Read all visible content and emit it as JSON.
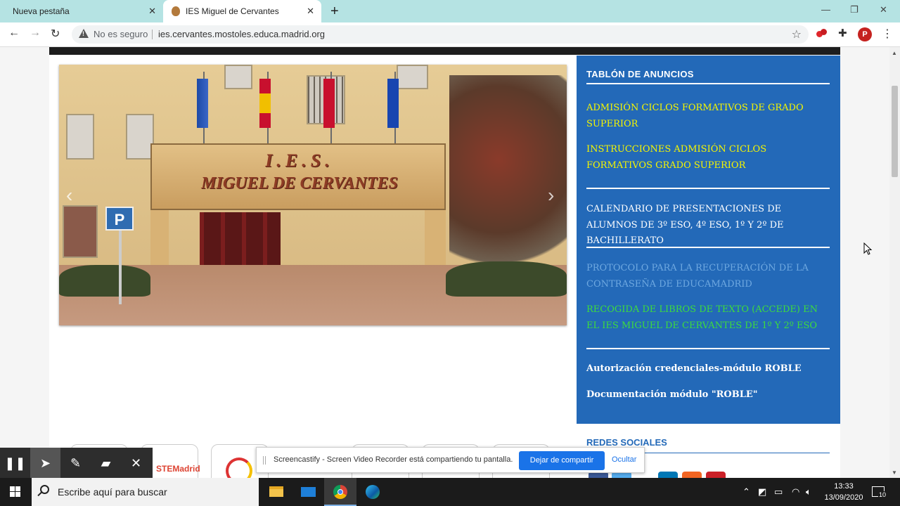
{
  "browser": {
    "tabs": [
      {
        "title": "Nueva pestaña"
      },
      {
        "title": "IES Miguel de Cervantes"
      }
    ],
    "new_tab": "+",
    "security_label": "No es seguro",
    "url": "ies.cervantes.mostoles.educa.madrid.org",
    "avatar_letter": "P",
    "window_controls": {
      "minimize": "—",
      "restore": "❐",
      "close": "✕"
    }
  },
  "carousel": {
    "sign_line1": "I.E.S.",
    "sign_line2": "MIGUEL DE CERVANTES",
    "parking_sign": "P",
    "prev": "‹",
    "next": "›"
  },
  "board": {
    "title": "TABLÓN DE ANUNCIOS",
    "items": [
      {
        "text": "ADMISIÓN CICLOS FORMATIVOS DE GRADO SUPERIOR",
        "color": "#f5f500"
      },
      {
        "text": "INSTRUCCIONES ADMISIÓN CICLOS FORMATIVOS GRADO SUPERIOR",
        "color": "#f5f500"
      },
      {
        "text": "CALENDARIO DE PRESENTACIONES DE ALUMNOS DE 3º ESO, 4º ESO, 1º Y 2º DE BACHILLERATO",
        "color": "#ffffff"
      },
      {
        "text": "PROTOCOLO PARA LA RECUPERACIÓN DE LA CONTRASEÑA DE EDUCAMADRID",
        "color": "#6ea8e0"
      },
      {
        "text": "RECOGIDA DE LIBROS DE TEXTO (ACCEDE) EN EL IES MIGUEL DE CERVANTES DE 1º Y 2º ESO",
        "color": "#3ddc3d"
      },
      {
        "text": "Autorización credenciales-módulo ROBLE",
        "color": "#ffffff"
      },
      {
        "text": "Documentación módulo \"ROBLE\"",
        "color": "#ffffff"
      }
    ]
  },
  "social": {
    "title": "REDES SOCIALES"
  },
  "logos": {
    "stem": "STEMadrid"
  },
  "screencastify": {
    "notice": "Screencastify - Screen Video Recorder está compartiendo tu pantalla.",
    "stop_button": "Dejar de compartir",
    "hide_link": "Ocultar"
  },
  "taskbar": {
    "search_placeholder": "Escribe aquí para buscar",
    "time": "13:33",
    "date": "13/09/2020",
    "notification_count": "10"
  },
  "colors": {
    "board_bg": "#2369b8",
    "tabstrip_bg": "#b5e3e3",
    "accent_blue": "#1a73e8"
  }
}
